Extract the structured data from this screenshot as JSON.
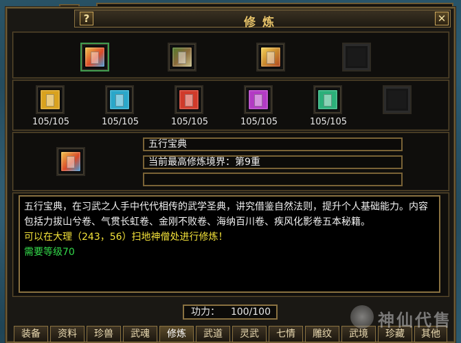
{
  "window": {
    "title": "修炼",
    "help_label": "?",
    "close_label": "✕"
  },
  "top_items": [
    {
      "name": "item-1",
      "color": "#3f9ad8",
      "selected": true
    },
    {
      "name": "item-2",
      "color": "#8a6a3a",
      "selected": false
    },
    {
      "name": "item-3",
      "color": "#c98a2e",
      "selected": false
    },
    {
      "name": "empty",
      "color": "#1a1a1a",
      "selected": false
    }
  ],
  "books": [
    {
      "count": "105/105",
      "color": "#d9a21e"
    },
    {
      "count": "105/105",
      "color": "#2aa7c9"
    },
    {
      "count": "105/105",
      "color": "#d03a2a"
    },
    {
      "count": "105/105",
      "color": "#b33ac4"
    },
    {
      "count": "105/105",
      "color": "#2bb07a"
    },
    {
      "count": "",
      "color": "#1a1a1a"
    }
  ],
  "detail": {
    "name": "五行宝典",
    "realm": "当前最高修炼境界：第9重",
    "extra": ""
  },
  "description": {
    "text": "五行宝典，在习武之人手中代代相传的武学圣典，讲究借鉴自然法则，提升个人基础能力。内容包括力拔山兮卷、气贯长虹卷、金刚不败卷、海纳百川卷、疾风化影卷五本秘籍。",
    "location": "可以在大理（243，56）扫地神僧处进行修炼！",
    "requirement": "需要等级70"
  },
  "power": {
    "label": "功力：",
    "value": "100/100"
  },
  "tabs": [
    {
      "label": "装备",
      "active": false
    },
    {
      "label": "资料",
      "active": false
    },
    {
      "label": "珍兽",
      "active": false
    },
    {
      "label": "武魂",
      "active": false
    },
    {
      "label": "修炼",
      "active": true
    },
    {
      "label": "武道",
      "active": false
    },
    {
      "label": "灵武",
      "active": false
    },
    {
      "label": "七情",
      "active": false
    },
    {
      "label": "雕纹",
      "active": false
    },
    {
      "label": "武境",
      "active": false
    },
    {
      "label": "珍藏",
      "active": false
    },
    {
      "label": "其他",
      "active": false
    }
  ],
  "watermark": {
    "text": "神仙代售"
  }
}
